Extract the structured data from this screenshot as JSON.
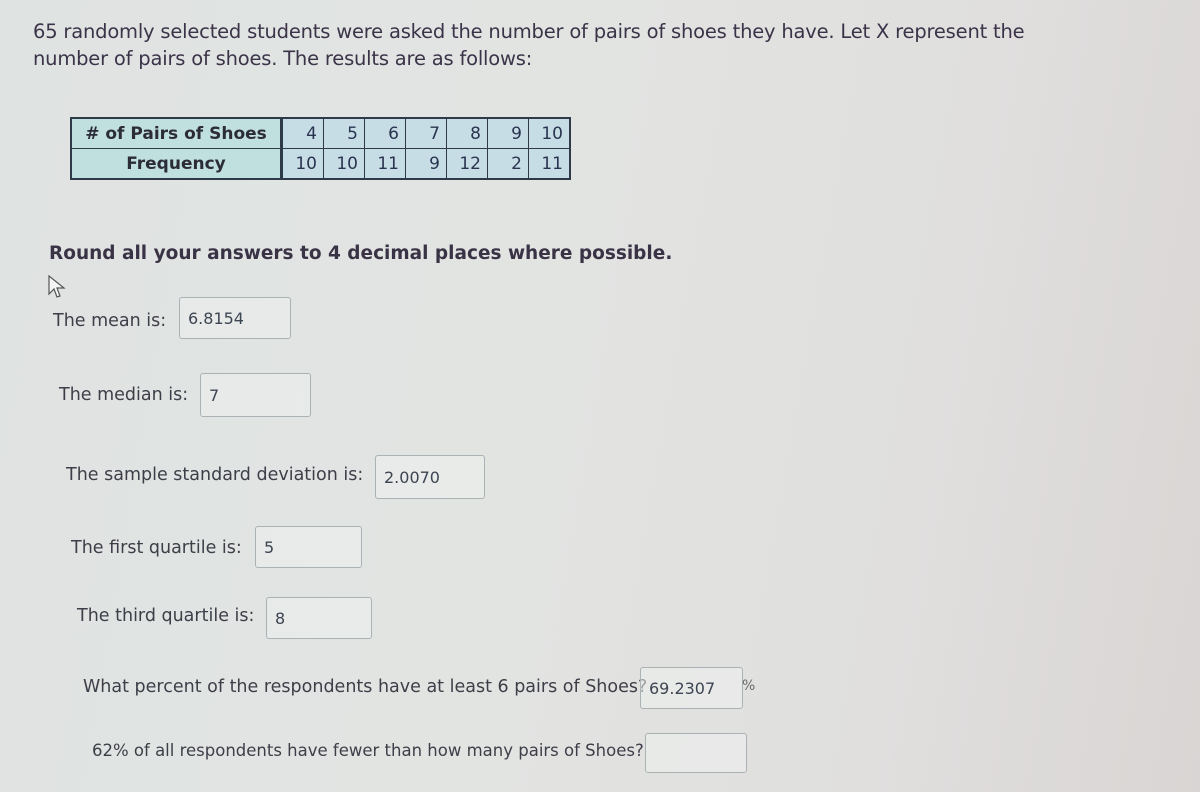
{
  "intro": {
    "line1": "65 randomly selected students were asked the number of pairs of shoes they have. Let X represent the",
    "line2": "number of pairs of shoes. The results are as follows:"
  },
  "table": {
    "row_headers": [
      "# of Pairs of Shoes",
      "Frequency"
    ],
    "pairs": [
      "4",
      "5",
      "6",
      "7",
      "8",
      "9",
      "10"
    ],
    "frequency": [
      "10",
      "10",
      "11",
      "9",
      "12",
      "2",
      "11"
    ]
  },
  "instruction": "Round all your answers to 4 decimal places where possible.",
  "questions": {
    "mean": {
      "label": "The mean is:",
      "value": "6.8154"
    },
    "median": {
      "label": "The median is:",
      "value": "7"
    },
    "sd": {
      "label": "The sample standard deviation is:",
      "value": "2.0070"
    },
    "q1": {
      "label": "The first quartile is:",
      "value": "5"
    },
    "q3": {
      "label": "The third quartile is:",
      "value": "8"
    },
    "percent_at_least_6": {
      "label": "What percent of the respondents have at least 6 pairs of Shoes?",
      "value": "69.2307",
      "unit": "%"
    },
    "percentile_62": {
      "label": "62% of all respondents have fewer than how many pairs of Shoes?",
      "value": ""
    }
  },
  "icons": {
    "cursor": "mouse-pointer-icon"
  }
}
